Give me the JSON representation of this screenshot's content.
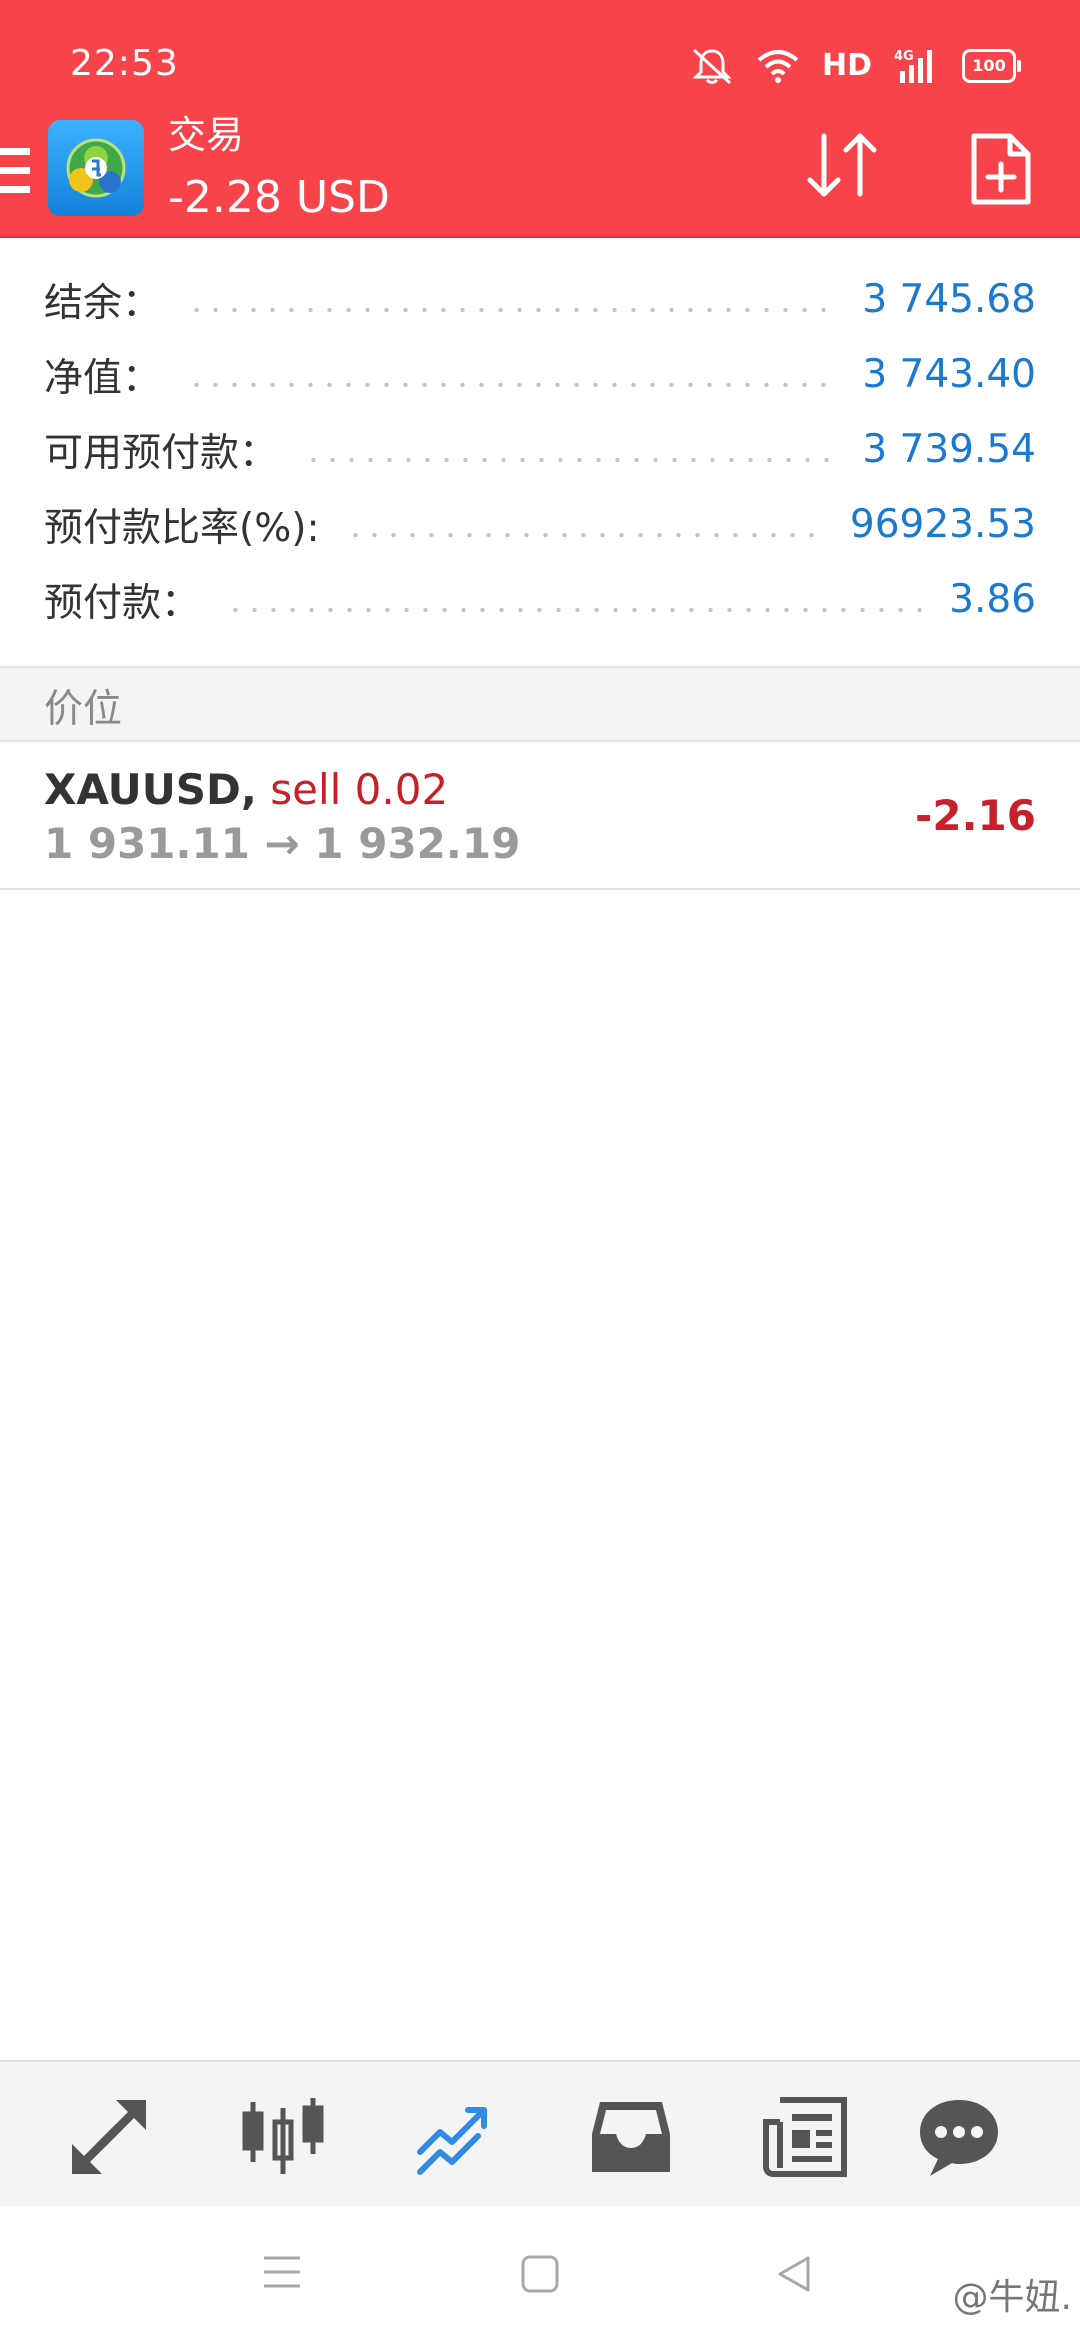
{
  "status_bar": {
    "time": "22:53",
    "network_label": "HD",
    "signal_label": "4G",
    "battery": "100"
  },
  "toolbar": {
    "title": "交易",
    "balance": "-2.28 USD"
  },
  "summary": [
    {
      "label": "结余：",
      "value": "3 745.68"
    },
    {
      "label": "净值：",
      "value": "3 743.40"
    },
    {
      "label": "可用预付款：",
      "value": "3 739.54"
    },
    {
      "label": "预付款比率(%):",
      "value": "96923.53"
    },
    {
      "label": "预付款：",
      "value": "3.86"
    }
  ],
  "positions_section": {
    "title": "价位"
  },
  "positions": [
    {
      "symbol": "XAUUSD,",
      "order": "sell 0.02",
      "open_price": "1 931.11",
      "arrow": "→",
      "current_price": "1 932.19",
      "profit": "-2.16"
    }
  ],
  "bottom_nav": [
    {
      "icon": "quotes-icon",
      "active": false
    },
    {
      "icon": "chart-icon",
      "active": false
    },
    {
      "icon": "trade-icon",
      "active": true
    },
    {
      "icon": "history-icon",
      "active": false
    },
    {
      "icon": "news-icon",
      "active": false
    },
    {
      "icon": "messages-icon",
      "active": false
    }
  ],
  "watermark": "@牛妞.",
  "colors": {
    "header": "#f7444a",
    "value_blue": "#1a7ad0",
    "loss_red": "#c8202a",
    "active_tab": "#2f8be6",
    "inactive_tab": "#555555"
  }
}
